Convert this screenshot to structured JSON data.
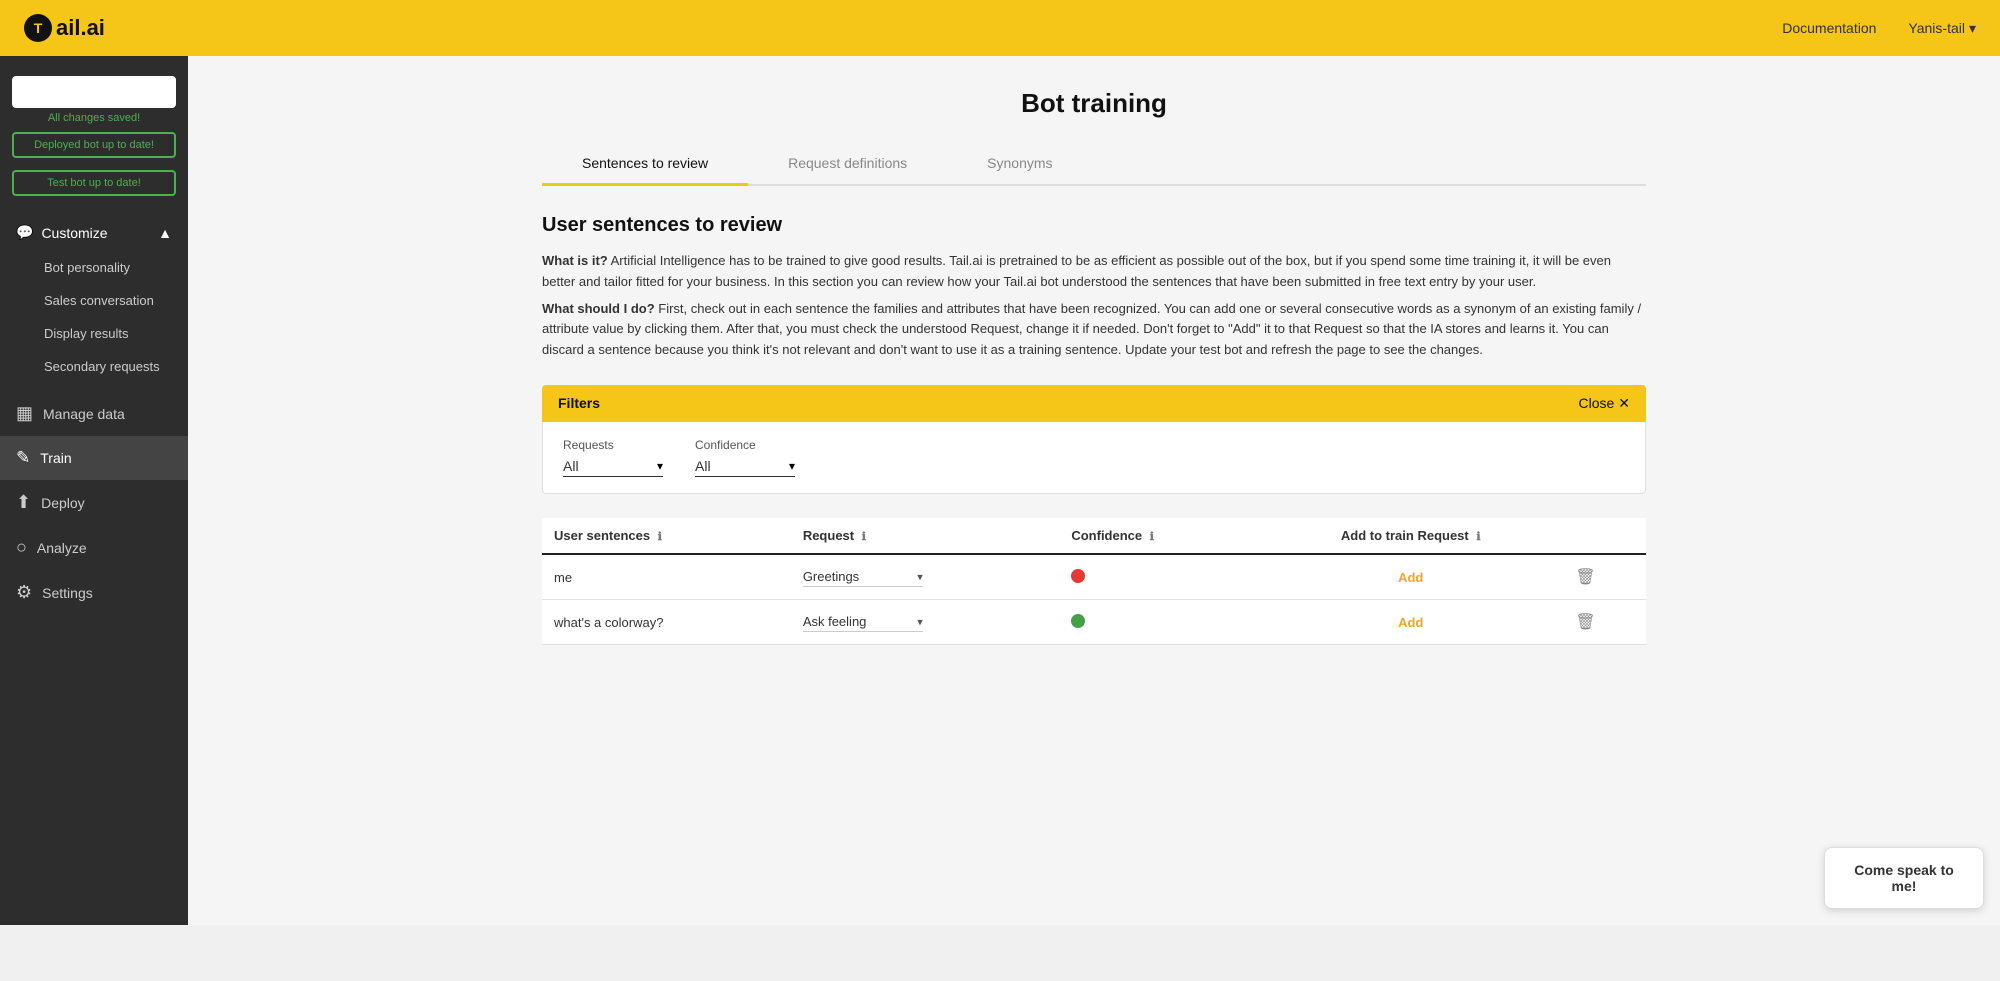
{
  "topbar": {
    "logo_text": "ail.ai",
    "doc_link": "Documentation",
    "user_label": "Yanis-tail",
    "user_arrow": "▾"
  },
  "sidebar": {
    "bot_selector_placeholder": "",
    "saved_text": "All changes saved!",
    "deployed_btn": "Deployed bot up to date!",
    "test_btn": "Test bot up to date!",
    "customize_label": "Customize",
    "sub_items": [
      {
        "label": "Bot personality"
      },
      {
        "label": "Sales conversation"
      },
      {
        "label": "Display results"
      },
      {
        "label": "Secondary requests"
      }
    ],
    "nav_items": [
      {
        "label": "Manage data",
        "icon": "☰"
      },
      {
        "label": "Train",
        "icon": "✎",
        "active": true
      },
      {
        "label": "Deploy",
        "icon": "⬆"
      },
      {
        "label": "Analyze",
        "icon": "○"
      },
      {
        "label": "Settings",
        "icon": "⚙"
      }
    ]
  },
  "main": {
    "page_title": "Bot training",
    "tabs": [
      {
        "label": "Sentences to review",
        "active": true
      },
      {
        "label": "Request definitions"
      },
      {
        "label": "Synonyms"
      }
    ],
    "section_title": "User sentences to review",
    "what_is_it_label": "What is it?",
    "what_is_it_text": " Artificial Intelligence has to be trained to give good results. Tail.ai is pretrained to be as efficient as possible out of the box, but if you spend some time training it, it will be even better and tailor fitted for your business. In this section you can review how your Tail.ai bot understood the sentences that have been submitted in free text entry by your user.",
    "what_should_label": "What should I do?",
    "what_should_text": " First, check out in each sentence the families and attributes that have been recognized. You can add one or several consecutive words as a synonym of an existing family / attribute value by clicking them. After that, you must check the understood Request, change it if needed. Don't forget to \"Add\" it to that Request so that the IA stores and learns it. You can discard a sentence because you think it's not relevant and don't want to use it as a training sentence. Update your test bot and refresh the page to see the changes.",
    "filters": {
      "label": "Filters",
      "close_label": "Close",
      "requests_label": "Requests",
      "requests_value": "All",
      "confidence_label": "Confidence",
      "confidence_value": "All"
    },
    "table": {
      "col_sentences": "User sentences",
      "col_request": "Request",
      "col_confidence": "Confidence",
      "col_add": "Add to train Request",
      "rows": [
        {
          "sentence": "me",
          "request": "Greetings",
          "confidence": "red",
          "add_label": "Add"
        },
        {
          "sentence": "what's a colorway?",
          "request": "Ask feeling",
          "confidence": "green",
          "add_label": "Add"
        }
      ]
    }
  },
  "chat_bubble": {
    "text": "Come speak to me!"
  }
}
